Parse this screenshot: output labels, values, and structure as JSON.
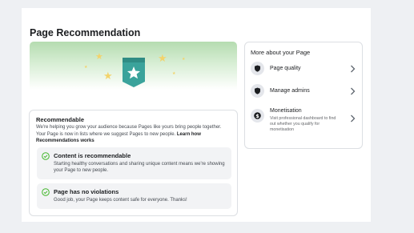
{
  "page": {
    "title": "Page Recommendation"
  },
  "recommendable": {
    "title": "Recommendable",
    "description": "We're helping you grow your audience because Pages like yours bring people together. Your Page is now in lists where we suggest Pages to new people.",
    "link": "Learn how Recommendations works"
  },
  "statuses": [
    {
      "title": "Content is recommendable",
      "text": "Starting healthy conversations and sharing unique content means we're showing your Page to new people."
    },
    {
      "title": "Page has no violations",
      "text": "Good job, your Page keeps content safe for everyone. Thanks!"
    }
  ],
  "sidebar": {
    "title": "More about your Page",
    "items": [
      {
        "label": "Page quality",
        "icon": "shield-icon"
      },
      {
        "label": "Manage admins",
        "icon": "shield-icon"
      },
      {
        "label": "Monetisation",
        "sub": "Visit professional dashboard to find out whether you qualify for monetisation",
        "icon": "dollar-icon"
      }
    ]
  },
  "colors": {
    "check": "#42b72a",
    "star": "#f3d36b",
    "shield": "#3aa39b",
    "hero": "#b5dcb0"
  }
}
